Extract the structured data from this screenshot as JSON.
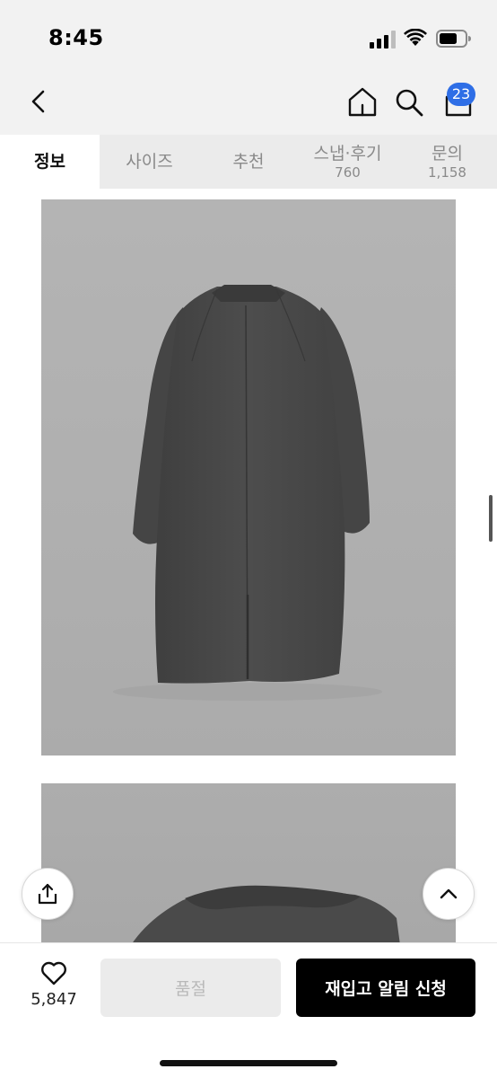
{
  "status_bar": {
    "time": "8:45",
    "icons": [
      "signal-icon",
      "wifi-icon",
      "battery-icon"
    ]
  },
  "header": {
    "back_icon": "chevron-left-icon",
    "home_icon": "home-icon",
    "search_icon": "search-icon",
    "cart_icon": "shopping-bag-icon",
    "cart_badge": "23",
    "badge_color": "#2e6ee6"
  },
  "tabs": [
    {
      "label": "정보",
      "count": "",
      "active": true
    },
    {
      "label": "사이즈",
      "count": "",
      "active": false
    },
    {
      "label": "추천",
      "count": "",
      "active": false
    },
    {
      "label": "스냅·후기",
      "count": "760",
      "active": false
    },
    {
      "label": "문의",
      "count": "1,158",
      "active": false
    }
  ],
  "floating": {
    "share_icon": "share-icon",
    "scroll_top_icon": "chevron-up-icon"
  },
  "bottom_bar": {
    "like_icon": "heart-icon",
    "like_count": "5,847",
    "soldout_label": "품절",
    "restock_label": "재입고 알림 신청"
  },
  "colors": {
    "primary_button": "#000000",
    "disabled_button": "#ebebeb",
    "tab_bar": "#ebebeb",
    "header_bg": "#f2f2f2"
  }
}
